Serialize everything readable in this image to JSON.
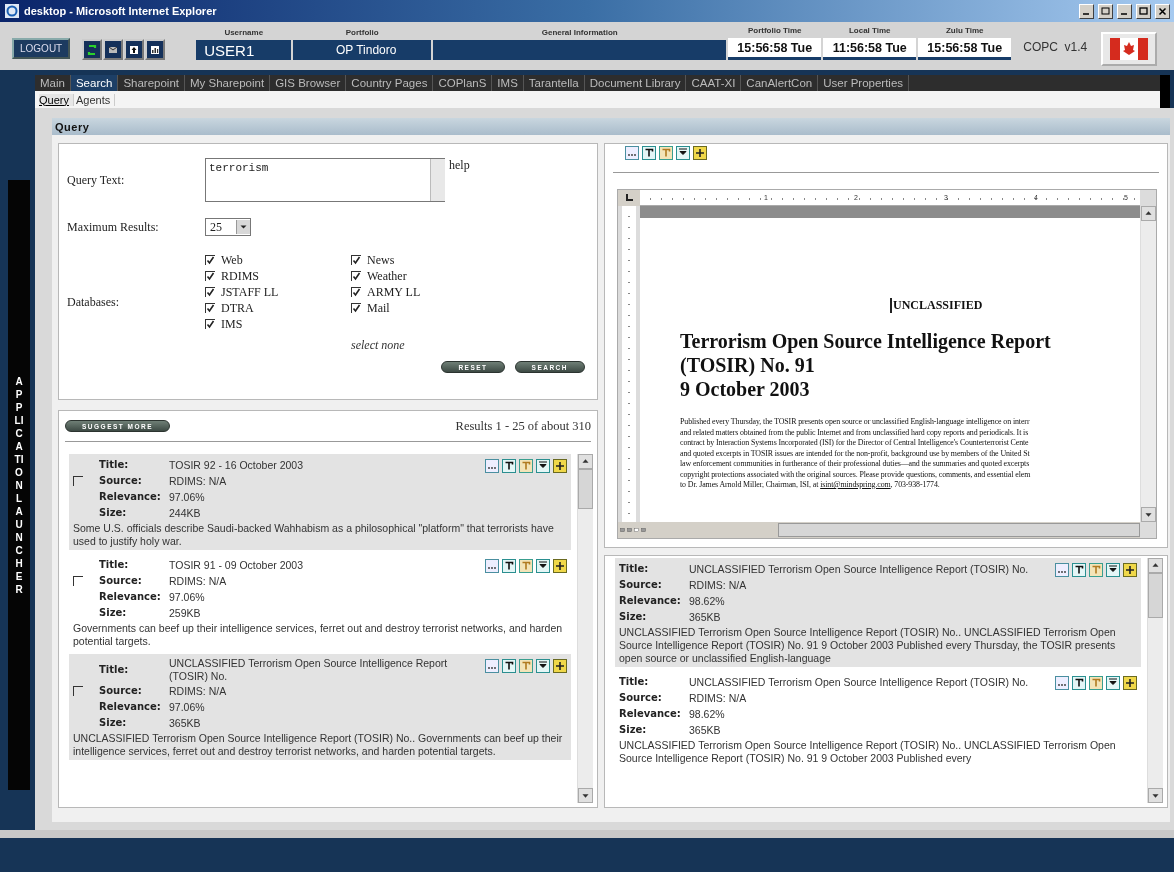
{
  "window": {
    "title": "desktop - Microsoft Internet Explorer"
  },
  "header": {
    "logout": "LOGOUT",
    "fields": [
      {
        "label": "Username",
        "value": "USER1",
        "kind": "user"
      },
      {
        "label": "Portfolio",
        "value": "OP Tindoro",
        "kind": "portfolio"
      },
      {
        "label": "General Information",
        "kind": "info"
      }
    ],
    "clocks": [
      {
        "label": "Portfolio Time",
        "value": "15:56:58 Tue"
      },
      {
        "label": "Local Time",
        "value": "11:56:58 Tue"
      },
      {
        "label": "Zulu Time",
        "value": "15:56:58 Tue"
      }
    ],
    "version": "COPC  v1.4"
  },
  "launcher": {
    "label": "APPLICATION LAUNCHER"
  },
  "nav_tabs": [
    {
      "label": "Main",
      "selected": false
    },
    {
      "label": "Search",
      "selected": true
    },
    {
      "label": "Sharepoint",
      "selected": false
    },
    {
      "label": "My Sharepoint",
      "selected": false
    },
    {
      "label": "GIS Browser",
      "selected": false
    },
    {
      "label": "Country Pages",
      "selected": false
    },
    {
      "label": "COPlanS",
      "selected": false
    },
    {
      "label": "IMS",
      "selected": false
    },
    {
      "label": "Tarantella",
      "selected": false
    },
    {
      "label": "Document Library",
      "selected": false
    },
    {
      "label": "CAAT-XI",
      "selected": false
    },
    {
      "label": "CanAlertCon",
      "selected": false
    },
    {
      "label": "User Properties",
      "selected": false
    }
  ],
  "sub_tabs": [
    {
      "label": "Query",
      "selected": true
    },
    {
      "label": "Agents",
      "selected": false
    }
  ],
  "section": {
    "title": "Query"
  },
  "query_form": {
    "query_label": "Query Text:",
    "query_text": "terrorism",
    "help": "help",
    "max_label": "Maximum Results:",
    "max_value": "25",
    "databases_label": "Databases:",
    "databases": [
      {
        "label": "Web",
        "checked": true
      },
      {
        "label": "RDIMS",
        "checked": true
      },
      {
        "label": "JSTAFF LL",
        "checked": true
      },
      {
        "label": "DTRA",
        "checked": true
      },
      {
        "label": "IMS",
        "checked": true
      },
      {
        "label": "News",
        "checked": true
      },
      {
        "label": "Weather",
        "checked": true
      },
      {
        "label": "ARMY LL",
        "checked": true
      },
      {
        "label": "Mail",
        "checked": true
      }
    ],
    "select_none": "select none",
    "buttons": [
      "RESET",
      "SEARCH"
    ]
  },
  "results": {
    "suggest_button": "SUGGEST MORE",
    "summary": "Results 1 - 25 of about 310",
    "items": [
      {
        "checked": false,
        "fields": [
          {
            "label": "Title:",
            "value": "TOSIR 92 - 16 October 2003"
          },
          {
            "label": "Source:",
            "value": "RDIMS: N/A"
          },
          {
            "label": "Relevance:",
            "value": "97.06%"
          },
          {
            "label": "Size:",
            "value": "244KB"
          }
        ],
        "snippet": "Some U.S. officials describe Saudi-backed Wahhabism as a philosophical \"platform\" that terrorists have used to justify holy war."
      },
      {
        "checked": false,
        "fields": [
          {
            "label": "Title:",
            "value": "TOSIR 91 - 09 October 2003"
          },
          {
            "label": "Source:",
            "value": "RDIMS: N/A"
          },
          {
            "label": "Relevance:",
            "value": "97.06%"
          },
          {
            "label": "Size:",
            "value": "259KB"
          }
        ],
        "snippet": "Governments can beef up their intelligence services, ferret out and destroy terrorist networks, and harden potential targets."
      },
      {
        "checked": false,
        "fields": [
          {
            "label": "Title:",
            "value": "UNCLASSIFIED Terrorism Open Source Intelligence Report (TOSIR) No."
          },
          {
            "label": "Source:",
            "value": "RDIMS: N/A"
          },
          {
            "label": "Relevance:",
            "value": "97.06%"
          },
          {
            "label": "Size:",
            "value": "365KB"
          }
        ],
        "snippet": "UNCLASSIFIED Terrorism Open Source Intelligence Report (TOSIR) No.. Governments can beef up their intelligence services, ferret out and destroy terrorist networks, and harden potential targets."
      }
    ]
  },
  "viewer": {
    "ruler": [
      "1",
      "2",
      "3",
      "4",
      "5"
    ],
    "classification": "UNCLASSIFIED",
    "title_lines": [
      "Terrorism Open Source Intelligence Report",
      "(TOSIR) No. 91",
      "9 October 2003"
    ],
    "body_lines": [
      "Published every Thursday, the TOSIR presents open source or unclassified English-language intelligence on interr",
      "and related matters obtained from the public Internet and from unclassified hard copy reports and periodicals. It is",
      "contract by Interaction Systems Incorporated (ISI) for the Director of Central Intelligence's Counterterrorist Cente",
      "and quoted excerpts in TOSIR issues are intended for the non-profit, background use by members of the United St",
      "law enforcement communities in furtherance of their professional duties—and the summaries and quoted excerpts",
      "copyright protections associated with the original sources. Please provide questions, comments, and essential elem"
    ],
    "contact": {
      "before": "to Dr. James Arnold Miller, Chairman, ISI, at ",
      "link": "isint@mindspring.com",
      "after": ", 703-938-1774."
    }
  },
  "preview_results": {
    "items": [
      {
        "fields": [
          {
            "label": "Title:",
            "value": "UNCLASSIFIED Terrorism Open Source Intelligence Report (TOSIR) No."
          },
          {
            "label": "Source:",
            "value": "RDIMS: N/A"
          },
          {
            "label": "Relevance:",
            "value": "98.62%"
          },
          {
            "label": "Size:",
            "value": "365KB"
          }
        ],
        "snippet": "UNCLASSIFIED Terrorism Open Source Intelligence Report (TOSIR) No.. UNCLASSIFIED Terrorism Open Source Intelligence Report (TOSIR) No. 91 9 October 2003 Published every Thursday, the TOSIR presents open source or unclassified English-language"
      },
      {
        "fields": [
          {
            "label": "Title:",
            "value": "UNCLASSIFIED Terrorism Open Source Intelligence Report (TOSIR) No."
          },
          {
            "label": "Source:",
            "value": "RDIMS: N/A"
          },
          {
            "label": "Relevance:",
            "value": "98.62%"
          },
          {
            "label": "Size:",
            "value": "365KB"
          }
        ],
        "snippet": "UNCLASSIFIED Terrorism Open Source Intelligence Report (TOSIR) No.. UNCLASSIFIED Terrorism Open Source Intelligence Report (TOSIR) No. 91 9 October 2003 Published every"
      }
    ]
  }
}
